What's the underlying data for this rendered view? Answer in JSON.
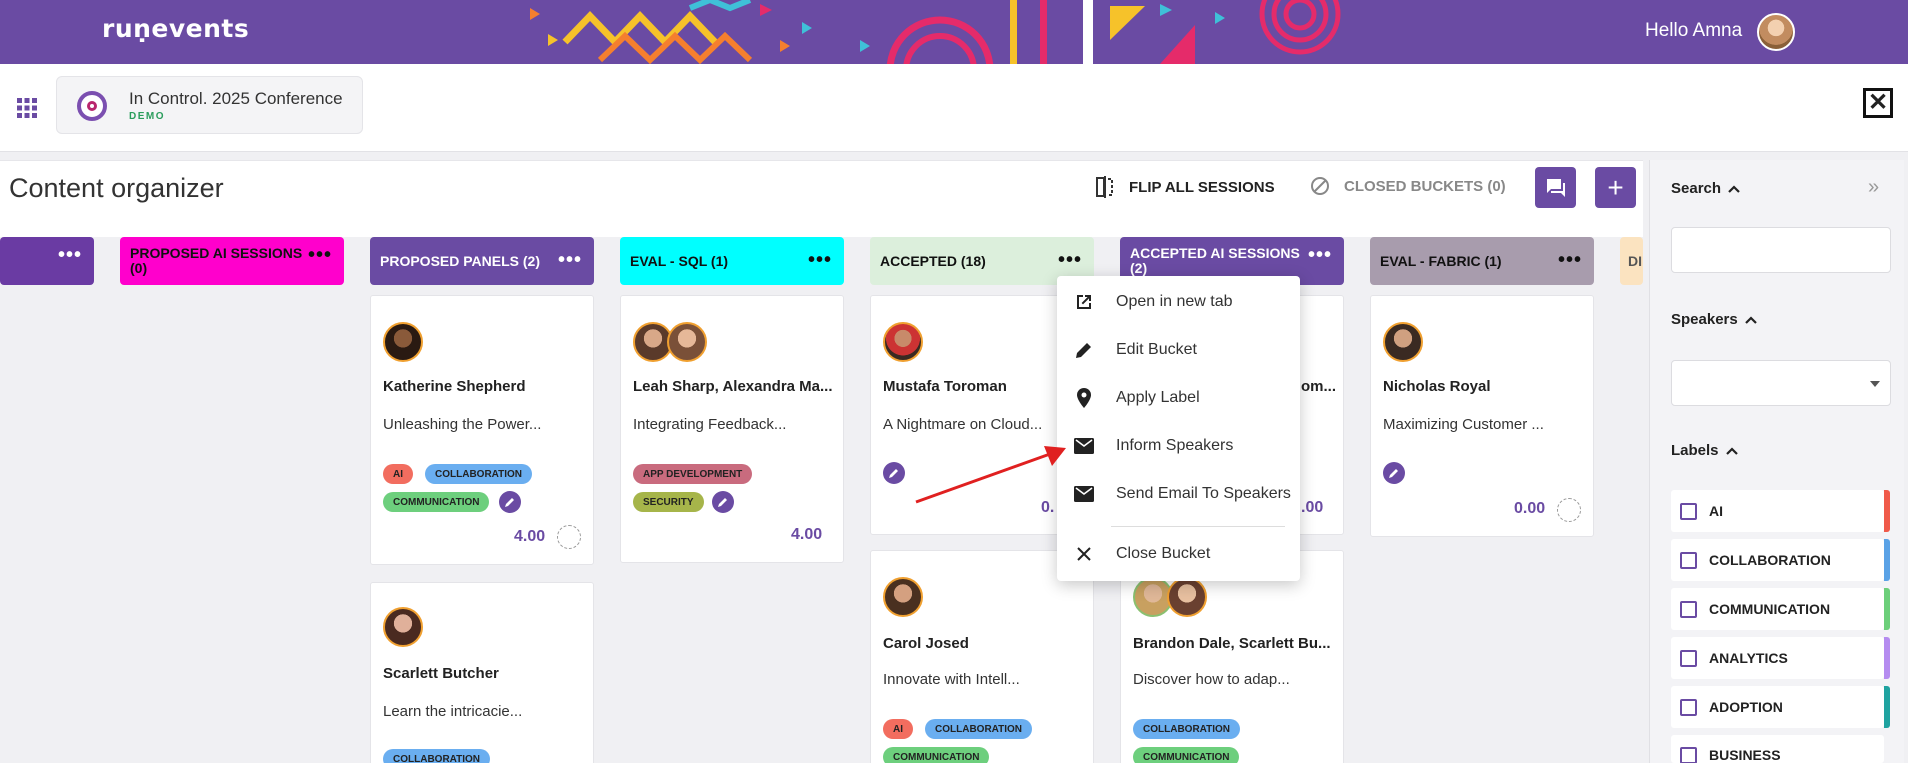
{
  "header": {
    "logo": "ruṇevents",
    "greeting": "Hello Amna"
  },
  "event": {
    "name": "In Control. 2025 Conference",
    "tag": "DEMO"
  },
  "page": {
    "title": "Content organizer",
    "flip_label": "FLIP ALL SESSIONS",
    "closed_label": "CLOSED BUCKETS (0)",
    "add_symbol": "+"
  },
  "columns": [
    {
      "label": "",
      "color": "#6a3ba3"
    },
    {
      "label": "PROPOSED AI SESSIONS (0)",
      "color": "#ff00cc"
    },
    {
      "label": "PROPOSED PANELS (2)",
      "color": "#6a4ba3"
    },
    {
      "label": "EVAL - SQL (1)",
      "color": "#00ffff"
    },
    {
      "label": "ACCEPTED (18)",
      "color": "#dcefdc"
    },
    {
      "label": "ACCEPTED AI SESSIONS (2)",
      "color": "#6a4ba3"
    },
    {
      "label": "EVAL - FABRIC (1)",
      "color": "#a89cad"
    },
    {
      "label": "DI",
      "color": "#fbe3c0"
    }
  ],
  "cards": {
    "katherine": {
      "name": "Katherine Shepherd",
      "title": "Unleashing the Power...",
      "score": "4.00",
      "tags": [
        "AI",
        "COLLABORATION",
        "COMMUNICATION"
      ]
    },
    "scarlett": {
      "name": "Scarlett Butcher",
      "title": "Learn the intricacie...",
      "tags": [
        "COLLABORATION"
      ]
    },
    "leah": {
      "name": "Leah Sharp, Alexandra Ma...",
      "title": "Integrating Feedback...",
      "score": "4.00",
      "tags": [
        "APP DEVELOPMENT",
        "SECURITY"
      ]
    },
    "mustafa": {
      "name": "Mustafa Toroman",
      "title": "A Nightmare on Cloud...",
      "score": "0."
    },
    "carol": {
      "name": "Carol Josed",
      "title": "Innovate with Intell...",
      "tags": [
        "AI",
        "COLLABORATION",
        "COMMUNICATION"
      ]
    },
    "accepted_ai_1": {
      "name": "om...",
      "score": ".00"
    },
    "brandon": {
      "name": "Brandon Dale, Scarlett Bu...",
      "title": "Discover how to adap...",
      "tags": [
        "COLLABORATION",
        "COMMUNICATION"
      ]
    },
    "nicholas": {
      "name": "Nicholas Royal",
      "title": "Maximizing Customer ...",
      "score": "0.00"
    }
  },
  "menu": {
    "items": [
      {
        "label": "Open in new tab",
        "icon": "open-in-new-icon"
      },
      {
        "label": "Edit Bucket",
        "icon": "pencil-icon"
      },
      {
        "label": "Apply Label",
        "icon": "location-pin-icon"
      },
      {
        "label": "Inform Speakers",
        "icon": "envelope-icon"
      },
      {
        "label": "Send Email To Speakers",
        "icon": "envelope-icon"
      },
      {
        "label": "Close Bucket",
        "icon": "close-icon"
      }
    ]
  },
  "sidebar": {
    "search_label": "Search",
    "speakers_label": "Speakers",
    "labels_label": "Labels",
    "labels": [
      {
        "label": "AI",
        "color": "#f05a4a"
      },
      {
        "label": "COLLABORATION",
        "color": "#5aa2e6"
      },
      {
        "label": "COMMUNICATION",
        "color": "#6ccf7a"
      },
      {
        "label": "ANALYTICS",
        "color": "#b58cf0"
      },
      {
        "label": "ADOPTION",
        "color": "#1fa3a0"
      },
      {
        "label": "BUSINESS",
        "color": "#cccccc"
      }
    ]
  },
  "colors": {
    "brand": "#6a4ba3",
    "tag_ai": "#f26d5f",
    "tag_collaboration": "#6aaef0",
    "tag_communication": "#6dcf7d",
    "tag_app_development": "#c96b7e",
    "tag_security": "#a6b54a"
  }
}
